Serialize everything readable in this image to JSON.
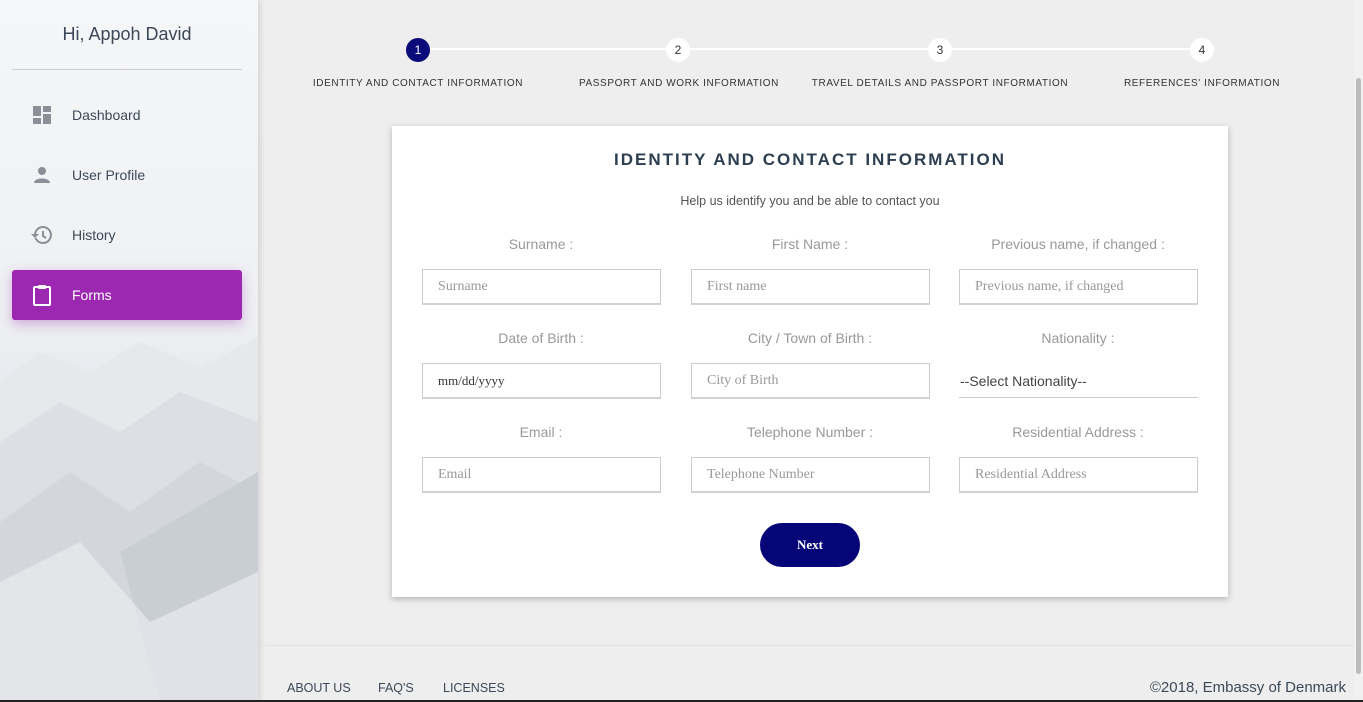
{
  "sidebar": {
    "user_greeting": "Hi, Appoh David",
    "items": [
      {
        "label": "Dashboard",
        "icon": "dashboard-icon"
      },
      {
        "label": "User Profile",
        "icon": "person-icon"
      },
      {
        "label": "History",
        "icon": "history-icon"
      },
      {
        "label": "Forms",
        "icon": "clipboard-icon",
        "active": true
      }
    ]
  },
  "stepper": {
    "steps": [
      {
        "number": "1",
        "label": "IDENTITY AND CONTACT INFORMATION",
        "active": true
      },
      {
        "number": "2",
        "label": "PASSPORT AND WORK INFORMATION"
      },
      {
        "number": "3",
        "label": "TRAVEL DETAILS AND PASSPORT INFORMATION"
      },
      {
        "number": "4",
        "label": "REFERENCES' INFORMATION"
      }
    ]
  },
  "form": {
    "title": "IDENTITY AND CONTACT INFORMATION",
    "subtitle": "Help us identify you and be able to contact you",
    "fields": {
      "surname": {
        "label": "Surname :",
        "placeholder": "Surname"
      },
      "first_name": {
        "label": "First Name :",
        "placeholder": "First name"
      },
      "previous_name": {
        "label": "Previous name, if changed :",
        "placeholder": "Previous name, if changed"
      },
      "dob": {
        "label": "Date of Birth :",
        "placeholder": "mm/dd/yyyy"
      },
      "city": {
        "label": "City / Town of Birth :",
        "placeholder": "City of Birth"
      },
      "nationality": {
        "label": "Nationality :",
        "selected": "--Select Nationality--"
      },
      "email": {
        "label": "Email :",
        "placeholder": "Email"
      },
      "telephone": {
        "label": "Telephone Number :",
        "placeholder": "Telephone Number"
      },
      "address": {
        "label": "Residential Address :",
        "placeholder": "Residential Address"
      }
    },
    "next_label": "Next"
  },
  "footer": {
    "links": [
      "ABOUT US",
      "FAQ'S",
      "LICENSES"
    ],
    "copyright": "©2018, Embassy of Denmark"
  },
  "colors": {
    "accent": "#9c27b0",
    "primary_dark": "#050577",
    "background": "#eeeeee"
  }
}
